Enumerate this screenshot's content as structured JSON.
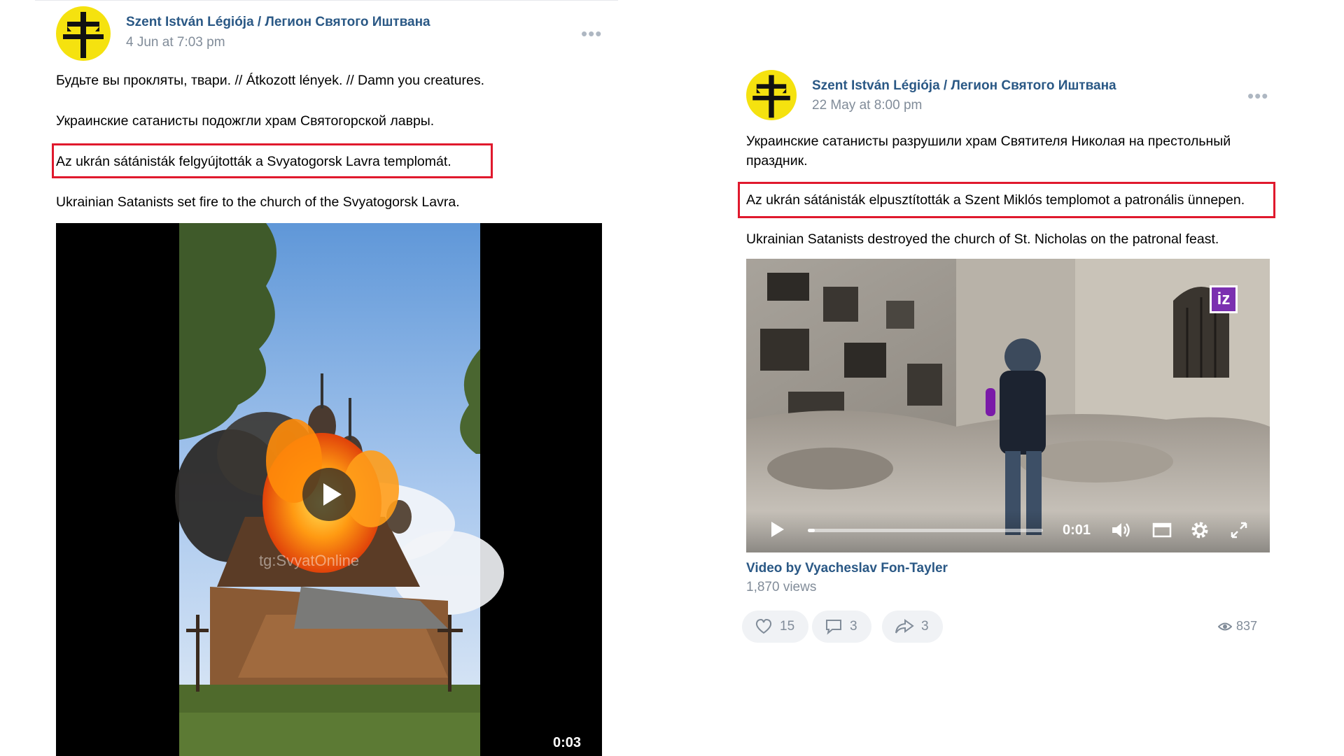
{
  "left_post": {
    "author": "Szent István Légiója / Легион Святого Иштвана",
    "date": "4 Jun at 7:03 pm",
    "line1": "Будьте вы прокляты, твари. // Átkozott lények. // Damn you creatures.",
    "line2": "Украинские сатанисты подожгли храм Святогорской лавры.",
    "line3": "Az ukrán sátánisták felgyújtották a Svyatogorsk Lavra templomát.",
    "line4": "Ukrainian Satanists set fire to the church of the Svyatogorsk Lavra.",
    "video": {
      "watermark": "tg:SvyatOnline",
      "duration": "0:03"
    }
  },
  "right_post": {
    "author": "Szent István Légiója / Легион Святого Иштвана",
    "date": "22 May at 8:00 pm",
    "line1": "Украинские сатанисты разрушили храм Святителя Николая на престольный праздник.",
    "line2": "Az ukrán sátánisták elpusztították a Szent Miklós templomot a patronális ünnepen.",
    "line3": "Ukrainian Satanists destroyed the church of St. Nicholas on the patronal feast.",
    "video": {
      "logo": "iz",
      "time": "0:01",
      "progress": 0.03,
      "credit": "Video by Vyacheslav Fon-Tayler",
      "views": "1,870 views"
    },
    "actions": {
      "likes": "15",
      "comments": "3",
      "shares": "3",
      "post_views": "837"
    }
  },
  "colors": {
    "highlight": "#e0192d",
    "link": "#2a5885",
    "avatar": "#f5e20f",
    "iz_logo": "#7b2fb0"
  }
}
